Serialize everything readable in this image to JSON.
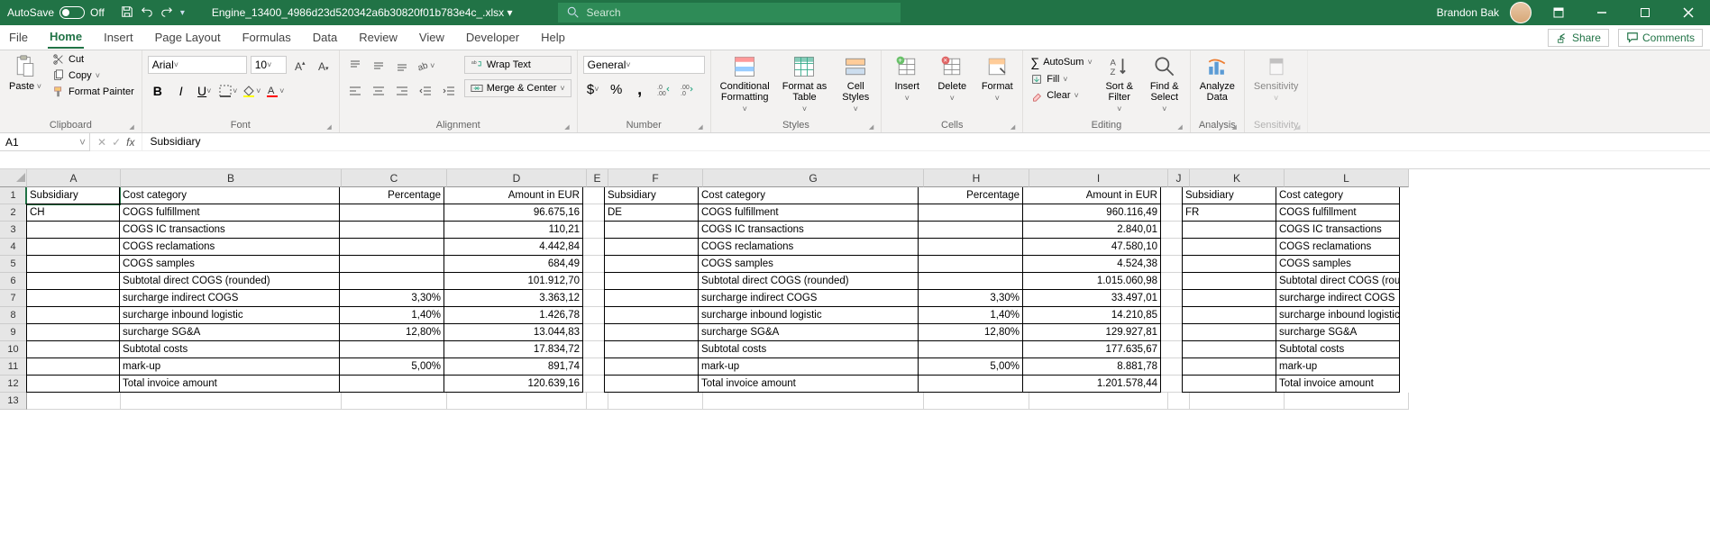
{
  "title_bar": {
    "autosave_label": "AutoSave",
    "autosave_state": "Off",
    "doc_name": "Engine_13400_4986d23d520342a6b30820f01b783e4c_.xlsx ▾",
    "search_placeholder": "Search",
    "user_name": "Brandon Bak"
  },
  "tabs": {
    "items": [
      "File",
      "Home",
      "Insert",
      "Page Layout",
      "Formulas",
      "Data",
      "Review",
      "View",
      "Developer",
      "Help"
    ],
    "active": "Home",
    "share": "Share",
    "comments": "Comments"
  },
  "ribbon": {
    "clipboard": {
      "paste": "Paste",
      "cut": "Cut",
      "copy": "Copy",
      "format_painter": "Format Painter",
      "label": "Clipboard"
    },
    "font": {
      "name": "Arial",
      "size": "10",
      "label": "Font"
    },
    "alignment": {
      "wrap": "Wrap Text",
      "merge": "Merge & Center",
      "label": "Alignment"
    },
    "number": {
      "format": "General",
      "label": "Number"
    },
    "styles": {
      "cf": "Conditional\nFormatting",
      "fat": "Format as\nTable",
      "cs": "Cell\nStyles",
      "label": "Styles"
    },
    "cells": {
      "insert": "Insert",
      "delete": "Delete",
      "format": "Format",
      "label": "Cells"
    },
    "editing": {
      "autosum": "AutoSum",
      "fill": "Fill",
      "clear": "Clear",
      "sort": "Sort &\nFilter",
      "find": "Find &\nSelect",
      "label": "Editing"
    },
    "analysis": {
      "analyze": "Analyze\nData",
      "label": "Analysis"
    },
    "sensitivity": {
      "btn": "Sensitivity",
      "label": "Sensitivity"
    }
  },
  "formula_bar": {
    "name_box": "A1",
    "formula": "Subsidiary"
  },
  "columns": [
    "A",
    "B",
    "C",
    "D",
    "E",
    "F",
    "G",
    "H",
    "I",
    "J",
    "K",
    "L"
  ],
  "rows": [
    {
      "n": "1",
      "A": "Subsidiary",
      "B": "Cost category",
      "C": "Percentage",
      "D": "Amount in EUR",
      "E": "",
      "F": "Subsidiary",
      "G": "Cost category",
      "H": "Percentage",
      "I": "Amount in EUR",
      "J": "",
      "K": "Subsidiary",
      "L": "Cost category"
    },
    {
      "n": "2",
      "A": "CH",
      "B": "COGS fulfillment",
      "C": "",
      "D": "96.675,16",
      "E": "",
      "F": "DE",
      "G": "COGS fulfillment",
      "H": "",
      "I": "960.116,49",
      "J": "",
      "K": "FR",
      "L": "COGS fulfillment"
    },
    {
      "n": "3",
      "A": "",
      "B": "COGS IC transactions",
      "C": "",
      "D": "110,21",
      "E": "",
      "F": "",
      "G": "COGS IC transactions",
      "H": "",
      "I": "2.840,01",
      "J": "",
      "K": "",
      "L": "COGS IC transactions"
    },
    {
      "n": "4",
      "A": "",
      "B": "COGS reclamations",
      "C": "",
      "D": "4.442,84",
      "E": "",
      "F": "",
      "G": "COGS reclamations",
      "H": "",
      "I": "47.580,10",
      "J": "",
      "K": "",
      "L": "COGS reclamations"
    },
    {
      "n": "5",
      "A": "",
      "B": "COGS samples",
      "C": "",
      "D": "684,49",
      "E": "",
      "F": "",
      "G": "COGS samples",
      "H": "",
      "I": "4.524,38",
      "J": "",
      "K": "",
      "L": "COGS samples"
    },
    {
      "n": "6",
      "A": "",
      "B": "Subtotal direct COGS (rounded)",
      "C": "",
      "D": "101.912,70",
      "E": "",
      "F": "",
      "G": "Subtotal direct COGS (rounded)",
      "H": "",
      "I": "1.015.060,98",
      "J": "",
      "K": "",
      "L": "Subtotal direct COGS (round"
    },
    {
      "n": "7",
      "A": "",
      "B": "surcharge indirect COGS",
      "C": "3,30%",
      "D": "3.363,12",
      "E": "",
      "F": "",
      "G": "surcharge indirect COGS",
      "H": "3,30%",
      "I": "33.497,01",
      "J": "",
      "K": "",
      "L": "surcharge indirect COGS"
    },
    {
      "n": "8",
      "A": "",
      "B": "surcharge inbound logistic",
      "C": "1,40%",
      "D": "1.426,78",
      "E": "",
      "F": "",
      "G": "surcharge inbound logistic",
      "H": "1,40%",
      "I": "14.210,85",
      "J": "",
      "K": "",
      "L": "surcharge inbound logistic"
    },
    {
      "n": "9",
      "A": "",
      "B": "surcharge SG&A",
      "C": "12,80%",
      "D": "13.044,83",
      "E": "",
      "F": "",
      "G": "surcharge SG&A",
      "H": "12,80%",
      "I": "129.927,81",
      "J": "",
      "K": "",
      "L": "surcharge SG&A"
    },
    {
      "n": "10",
      "A": "",
      "B": "Subtotal costs",
      "C": "",
      "D": "17.834,72",
      "E": "",
      "F": "",
      "G": "Subtotal costs",
      "H": "",
      "I": "177.635,67",
      "J": "",
      "K": "",
      "L": "Subtotal costs"
    },
    {
      "n": "11",
      "A": "",
      "B": "mark-up",
      "C": "5,00%",
      "D": "891,74",
      "E": "",
      "F": "",
      "G": "mark-up",
      "H": "5,00%",
      "I": "8.881,78",
      "J": "",
      "K": "",
      "L": "mark-up"
    },
    {
      "n": "12",
      "A": "",
      "B": "Total invoice amount",
      "C": "",
      "D": "120.639,16",
      "E": "",
      "F": "",
      "G": "Total invoice amount",
      "H": "",
      "I": "1.201.578,44",
      "J": "",
      "K": "",
      "L": "Total invoice amount"
    },
    {
      "n": "13",
      "A": "",
      "B": "",
      "C": "",
      "D": "",
      "E": "",
      "F": "",
      "G": "",
      "H": "",
      "I": "",
      "J": "",
      "K": "",
      "L": ""
    }
  ],
  "bordered_cols": [
    "A",
    "B",
    "C",
    "D",
    "F",
    "G",
    "H",
    "I",
    "K",
    "L"
  ],
  "bordered_rows": [
    "1",
    "2",
    "3",
    "4",
    "5",
    "6",
    "7",
    "8",
    "9",
    "10",
    "11",
    "12"
  ],
  "ralign_cols": [
    "C",
    "D",
    "H",
    "I"
  ]
}
